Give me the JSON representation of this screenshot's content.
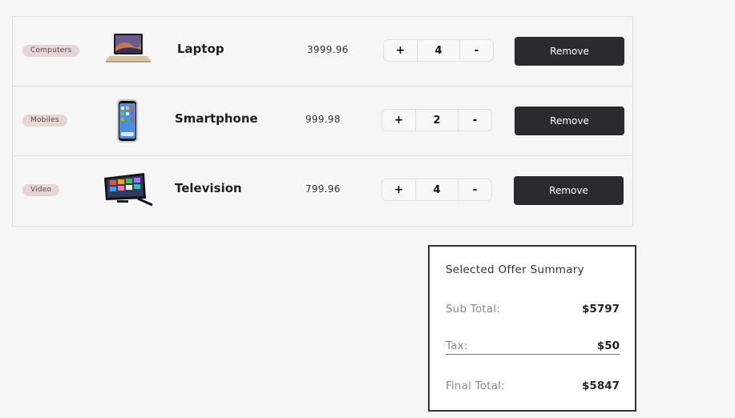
{
  "cart": {
    "items": [
      {
        "category": "Computers",
        "name": "Laptop",
        "price": "3999.96",
        "quantity": "4",
        "plus": "+",
        "minus": "-",
        "remove_label": "Remove"
      },
      {
        "category": "Mobiles",
        "name": "Smartphone",
        "price": "999.98",
        "quantity": "2",
        "plus": "+",
        "minus": "-",
        "remove_label": "Remove"
      },
      {
        "category": "Video",
        "name": "Television",
        "price": "799.96",
        "quantity": "4",
        "plus": "+",
        "minus": "-",
        "remove_label": "Remove"
      }
    ]
  },
  "summary": {
    "title": "Selected Offer Summary",
    "subtotal_label": "Sub Total:",
    "subtotal_value": "$5797",
    "tax_label": "Tax:",
    "tax_value": "$50",
    "final_label": "Final Total:",
    "final_value": "$5847"
  },
  "colors": {
    "button_dark": "#2a2b2e",
    "badge_bg": "#e6d5d5",
    "page_bg": "#f6f6f6"
  },
  "icons": [
    "laptop-image",
    "smartphone-image",
    "television-image"
  ]
}
